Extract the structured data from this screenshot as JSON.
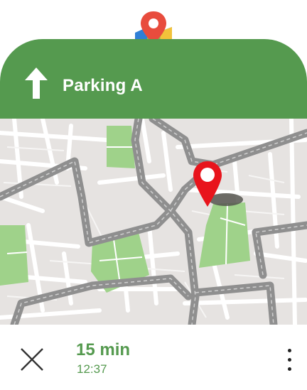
{
  "navigation": {
    "direction_icon": "arrow-up-icon",
    "destination": "Parking A"
  },
  "app": {
    "logo_icon": "maps-pin-logo-icon"
  },
  "trip": {
    "duration": "15 min",
    "arrival_time": "12:37"
  },
  "controls": {
    "close_icon": "close-icon",
    "more_icon": "more-vertical-icon"
  },
  "colors": {
    "header_green": "#559a4f",
    "park_green": "#9fd28a",
    "road_gray": "#8f8f8f",
    "pin_red": "#e8141c",
    "map_background": "#e6e3e1"
  }
}
